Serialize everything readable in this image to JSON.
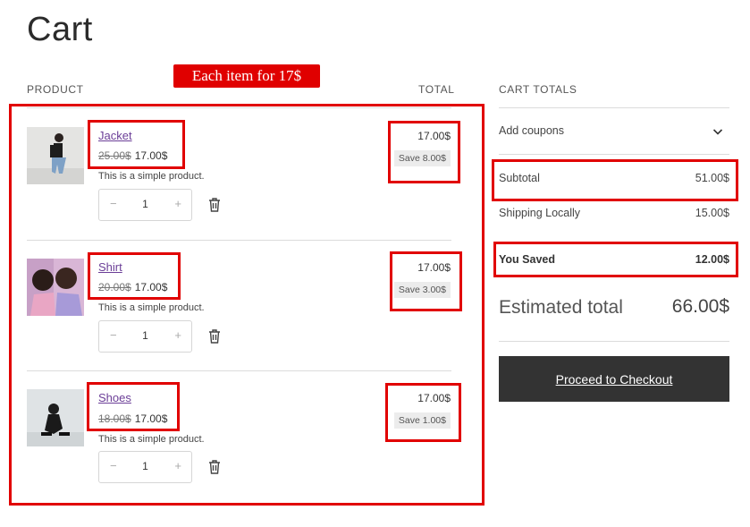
{
  "page": {
    "title": "Cart"
  },
  "annotation": {
    "callout": "Each item for 17$"
  },
  "table": {
    "product_header": "PRODUCT",
    "total_header": "TOTAL"
  },
  "items": [
    {
      "name": "Jacket",
      "old_price": "25.00$",
      "price": "17.00$",
      "description": "This is a simple product.",
      "quantity": "1",
      "line_total": "17.00$",
      "save": "Save 8.00$"
    },
    {
      "name": "Shirt",
      "old_price": "20.00$",
      "price": "17.00$",
      "description": "This is a simple product.",
      "quantity": "1",
      "line_total": "17.00$",
      "save": "Save 3.00$"
    },
    {
      "name": "Shoes",
      "old_price": "18.00$",
      "price": "17.00$",
      "description": "This is a simple product.",
      "quantity": "1",
      "line_total": "17.00$",
      "save": "Save 1.00$"
    }
  ],
  "qty_controls": {
    "minus": "−",
    "plus": "+"
  },
  "totals": {
    "header": "CART TOTALS",
    "coupons_label": "Add coupons",
    "subtotal_label": "Subtotal",
    "subtotal_value": "51.00$",
    "shipping_label": "Shipping Locally",
    "shipping_value": "15.00$",
    "saved_label": "You Saved",
    "saved_value": "12.00$",
    "estimated_label": "Estimated total",
    "estimated_value": "66.00$",
    "checkout_label": "Proceed to Checkout"
  },
  "colors": {
    "annotation_red": "#e00000",
    "link_purple": "#6b3e97",
    "checkout_bg": "#333333"
  },
  "icons": {
    "coupons_toggle": "chevron-down-icon",
    "remove_item": "trash-icon"
  }
}
